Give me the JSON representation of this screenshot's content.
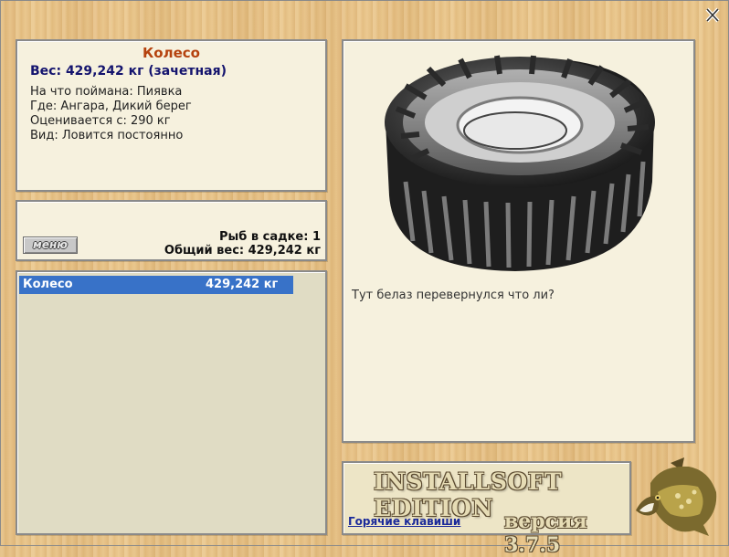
{
  "window": {
    "close_icon": "close-x-icon"
  },
  "catch_info": {
    "name": "Колесо",
    "weight": "Вес: 429,242 кг (зачетная)",
    "caught_on": "На что поймана: Пиявка",
    "location": "Где: Ангара, Дикий берег",
    "valued_from": "Оценивается с: 290 кг",
    "kind": "Вид: Ловится постоянно"
  },
  "keepnet": {
    "menu_label": "меню",
    "count": "Рыб в садке: 1",
    "total_weight": "Общий вес: 429,242 кг"
  },
  "catch_list": [
    {
      "name": "Колесо",
      "weight": "429,242 кг",
      "selected": true
    }
  ],
  "preview": {
    "image_icon": "tire-image",
    "description": "Тут белаз перевернулся что ли?"
  },
  "footer": {
    "edition": "INSTALLSOFT EDITION",
    "version": "версия 3.7.5",
    "hotkeys_label": "Горячие клавиши",
    "logo_icon": "pike-fish-icon"
  },
  "colors": {
    "title": "#b5420e",
    "weight": "#14146e",
    "selection": "#3872c8",
    "panel": "#f6f1de",
    "link": "#1b2a9a"
  }
}
